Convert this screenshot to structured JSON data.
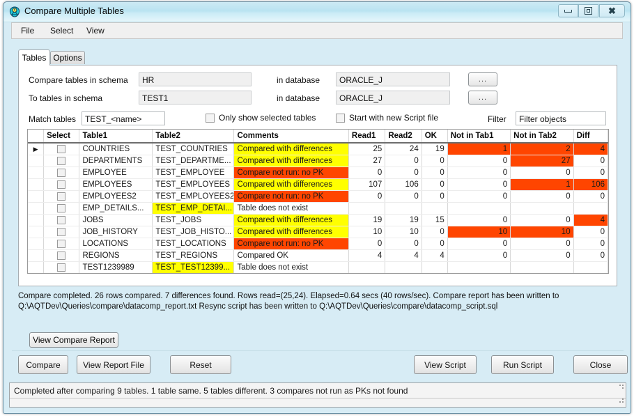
{
  "window": {
    "title": "Compare Multiple Tables",
    "app_icon": "app-icon",
    "controls": {
      "minimize": "minimize",
      "maximize": "maximize",
      "close": "close"
    }
  },
  "menubar": {
    "items": [
      "File",
      "Select",
      "View"
    ]
  },
  "tabs": [
    {
      "label": "Tables",
      "active": true
    },
    {
      "label": "Options",
      "active": false
    }
  ],
  "form": {
    "schema1_label": "Compare tables in schema",
    "schema1_value": "HR",
    "schema2_label": "To tables in schema",
    "schema2_value": "TEST1",
    "db1_label": "in database",
    "db1_value": "ORACLE_J",
    "db2_label": "in database",
    "db2_value": "ORACLE_J",
    "browse1_label": "...",
    "browse2_label": "...",
    "match_label": "Match tables",
    "match_value": "TEST_<name>",
    "only_selected_label": "Only show selected tables",
    "only_selected_checked": false,
    "new_script_label": "Start with new Script file",
    "new_script_checked": false,
    "filter_label": "Filter",
    "filter_value": "Filter objects"
  },
  "grid": {
    "columns": [
      "",
      "Select",
      "Table1",
      "Table2",
      "Comments",
      "Read1",
      "Read2",
      "OK",
      "Not in Tab1",
      "Not in Tab2",
      "Diff"
    ],
    "rows": [
      {
        "marker": "▶",
        "selected": false,
        "table1": "COUNTRIES",
        "table1_hl": "none",
        "table2": "TEST_COUNTRIES",
        "table2_hl": "none",
        "comments": "Compared with differences",
        "comments_hl": "yellow",
        "read1": "25",
        "read2": "24",
        "ok": "19",
        "not_in_tab1": "1",
        "not_in_tab1_hl": "orange",
        "not_in_tab2": "2",
        "not_in_tab2_hl": "orange",
        "diff": "4",
        "diff_hl": "orange"
      },
      {
        "marker": "",
        "selected": false,
        "table1": "DEPARTMENTS",
        "table1_hl": "none",
        "table2": "TEST_DEPARTME...",
        "table2_hl": "none",
        "comments": "Compared with differences",
        "comments_hl": "yellow",
        "read1": "27",
        "read2": "0",
        "ok": "0",
        "not_in_tab1": "0",
        "not_in_tab1_hl": "none",
        "not_in_tab2": "27",
        "not_in_tab2_hl": "orange",
        "diff": "0",
        "diff_hl": "none"
      },
      {
        "marker": "",
        "selected": false,
        "table1": "EMPLOYEE",
        "table1_hl": "none",
        "table2": "TEST_EMPLOYEE",
        "table2_hl": "none",
        "comments": "Compare not run: no PK",
        "comments_hl": "orange",
        "read1": "0",
        "read2": "0",
        "ok": "0",
        "not_in_tab1": "0",
        "not_in_tab1_hl": "none",
        "not_in_tab2": "0",
        "not_in_tab2_hl": "none",
        "diff": "0",
        "diff_hl": "none"
      },
      {
        "marker": "",
        "selected": false,
        "table1": "EMPLOYEES",
        "table1_hl": "none",
        "table2": "TEST_EMPLOYEES",
        "table2_hl": "none",
        "comments": "Compared with differences",
        "comments_hl": "yellow",
        "read1": "107",
        "read2": "106",
        "ok": "0",
        "not_in_tab1": "0",
        "not_in_tab1_hl": "none",
        "not_in_tab2": "1",
        "not_in_tab2_hl": "orange",
        "diff": "106",
        "diff_hl": "orange"
      },
      {
        "marker": "",
        "selected": false,
        "table1": "EMPLOYEES2",
        "table1_hl": "none",
        "table2": "TEST_EMPLOYEES2",
        "table2_hl": "none",
        "comments": "Compare not run: no PK",
        "comments_hl": "orange",
        "read1": "0",
        "read2": "0",
        "ok": "0",
        "not_in_tab1": "0",
        "not_in_tab1_hl": "none",
        "not_in_tab2": "0",
        "not_in_tab2_hl": "none",
        "diff": "0",
        "diff_hl": "none"
      },
      {
        "marker": "",
        "selected": false,
        "table1": "EMP_DETAILS...",
        "table1_hl": "none",
        "table2": "TEST_EMP_DETAI...",
        "table2_hl": "yellow",
        "comments": "Table does not exist",
        "comments_hl": "none",
        "read1": "",
        "read2": "",
        "ok": "",
        "not_in_tab1": "",
        "not_in_tab1_hl": "none",
        "not_in_tab2": "",
        "not_in_tab2_hl": "none",
        "diff": "",
        "diff_hl": "none"
      },
      {
        "marker": "",
        "selected": false,
        "table1": "JOBS",
        "table1_hl": "none",
        "table2": "TEST_JOBS",
        "table2_hl": "none",
        "comments": "Compared with differences",
        "comments_hl": "yellow",
        "read1": "19",
        "read2": "19",
        "ok": "15",
        "not_in_tab1": "0",
        "not_in_tab1_hl": "none",
        "not_in_tab2": "0",
        "not_in_tab2_hl": "none",
        "diff": "4",
        "diff_hl": "orange"
      },
      {
        "marker": "",
        "selected": false,
        "table1": "JOB_HISTORY",
        "table1_hl": "none",
        "table2": "TEST_JOB_HISTO...",
        "table2_hl": "none",
        "comments": "Compared with differences",
        "comments_hl": "yellow",
        "read1": "10",
        "read2": "10",
        "ok": "0",
        "not_in_tab1": "10",
        "not_in_tab1_hl": "orange",
        "not_in_tab2": "10",
        "not_in_tab2_hl": "orange",
        "diff": "0",
        "diff_hl": "none"
      },
      {
        "marker": "",
        "selected": false,
        "table1": "LOCATIONS",
        "table1_hl": "none",
        "table2": "TEST_LOCATIONS",
        "table2_hl": "none",
        "comments": "Compare not run: no PK",
        "comments_hl": "orange",
        "read1": "0",
        "read2": "0",
        "ok": "0",
        "not_in_tab1": "0",
        "not_in_tab1_hl": "none",
        "not_in_tab2": "0",
        "not_in_tab2_hl": "none",
        "diff": "0",
        "diff_hl": "none"
      },
      {
        "marker": "",
        "selected": false,
        "table1": "REGIONS",
        "table1_hl": "none",
        "table2": "TEST_REGIONS",
        "table2_hl": "none",
        "comments": "Compared OK",
        "comments_hl": "none",
        "read1": "4",
        "read2": "4",
        "ok": "4",
        "not_in_tab1": "0",
        "not_in_tab1_hl": "none",
        "not_in_tab2": "0",
        "not_in_tab2_hl": "none",
        "diff": "0",
        "diff_hl": "none"
      },
      {
        "marker": "",
        "selected": false,
        "table1": "TEST1239989",
        "table1_hl": "none",
        "table2": "TEST_TEST12399...",
        "table2_hl": "yellow",
        "comments": "Table does not exist",
        "comments_hl": "none",
        "read1": "",
        "read2": "",
        "ok": "",
        "not_in_tab1": "",
        "not_in_tab1_hl": "none",
        "not_in_tab2": "",
        "not_in_tab2_hl": "none",
        "diff": "",
        "diff_hl": "none"
      }
    ]
  },
  "message": {
    "line1": "Compare completed. 26 rows compared. 7 differences found. Rows read=(25,24). Elapsed=0.64 secs (40 rows/sec).   Compare report has been written to",
    "line2": "Q:\\AQTDev\\Queries\\compare\\datacomp_report.txt  Resync script has been written to Q:\\AQTDev\\Queries\\compare\\datacomp_script.sql"
  },
  "buttons": {
    "view_compare_report": "View Compare Report",
    "compare": "Compare",
    "view_report_file": "View Report File",
    "reset": "Reset",
    "view_script": "View Script",
    "run_script": "Run Script",
    "close": "Close"
  },
  "statusbar": {
    "text": "Completed after comparing 9 tables. 1 table same. 5 tables different. 3 compares not run as PKs not found"
  },
  "colors": {
    "title_bg": "#c4e7f3",
    "panel_bg": "#d7ecf5",
    "highlight_yellow": "#ffff00",
    "highlight_orange": "#ff4500",
    "tab_active": "#ffffff"
  }
}
